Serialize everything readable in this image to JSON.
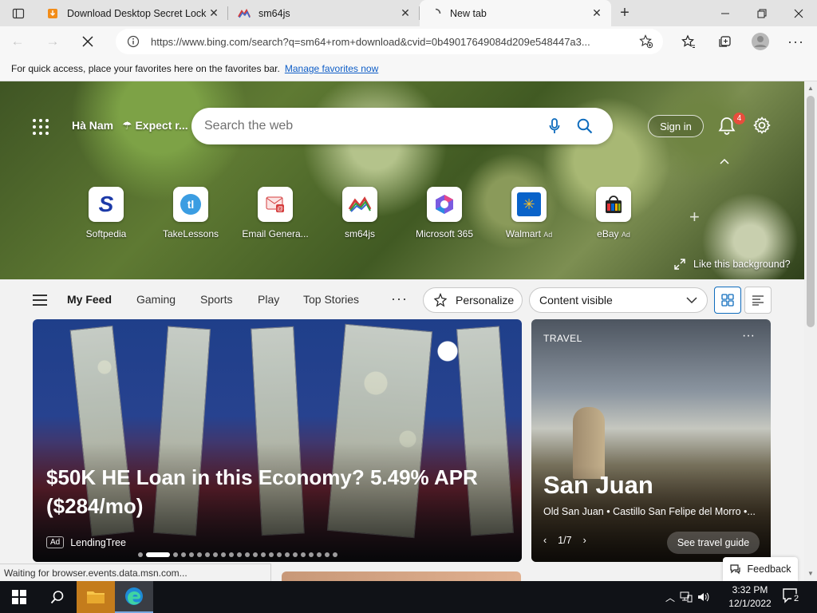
{
  "browser": {
    "tabs": [
      {
        "title": "Download Desktop Secret Lock",
        "favicon": "orange-download-icon",
        "active": false
      },
      {
        "title": "sm64js",
        "favicon": "sm64js-icon",
        "active": false
      },
      {
        "title": "New tab",
        "favicon": "loading-spinner-icon",
        "active": true
      }
    ],
    "address": "https://www.bing.com/search?q=sm64+rom+download&cvid=0b49017649084d209e548447a3...",
    "favorites_bar": {
      "message": "For quick access, place your favorites here on the favorites bar.",
      "link": "Manage favorites now"
    }
  },
  "newtab": {
    "location": "Hà Nam",
    "weather": "Expect r...",
    "search_placeholder": "Search the web",
    "sign_in": "Sign in",
    "notification_count": "4",
    "quick_links": [
      {
        "label": "Softpedia",
        "ad": ""
      },
      {
        "label": "TakeLessons",
        "ad": ""
      },
      {
        "label": "Email Genera...",
        "ad": ""
      },
      {
        "label": "sm64js",
        "ad": ""
      },
      {
        "label": "Microsoft 365",
        "ad": ""
      },
      {
        "label": "Walmart",
        "ad": "Ad"
      },
      {
        "label": "eBay",
        "ad": "Ad"
      }
    ],
    "like_background": "Like this background?"
  },
  "feed": {
    "tabs": [
      "My Feed",
      "Gaming",
      "Sports",
      "Play",
      "Top Stories"
    ],
    "personalize": "Personalize",
    "content_visible": "Content visible",
    "main_card": {
      "headline": "$50K HE Loan in this Economy? 5.49% APR ($284/mo)",
      "ad_label": "Ad",
      "source": "LendingTree",
      "carousel_index": 1,
      "carousel_total": 23
    },
    "travel_card": {
      "kicker": "TRAVEL",
      "city": "San Juan",
      "subtitle": "Old San Juan • Castillo San Felipe del Morro •...",
      "pager": "1/7",
      "button": "See travel guide"
    },
    "feedback": "Feedback"
  },
  "status_text": "Waiting for browser.events.data.msn.com...",
  "taskbar": {
    "time": "3:32 PM",
    "date": "12/1/2022",
    "notification_count": "2"
  },
  "colors": {
    "accent": "#0f6cbd",
    "link": "#0f5ec7",
    "badge": "#e84d3c",
    "taskbar": "#101217"
  }
}
